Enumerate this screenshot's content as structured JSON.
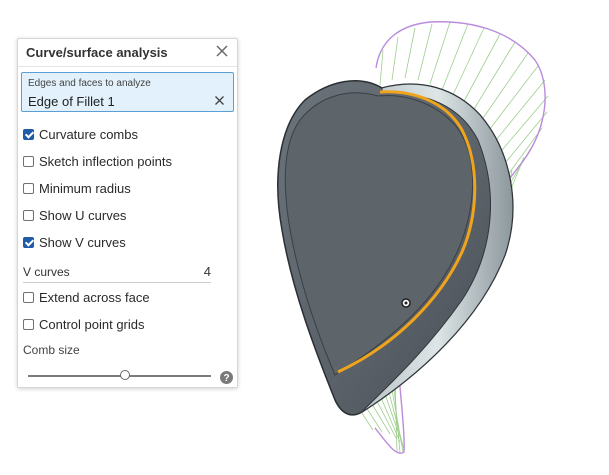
{
  "panel": {
    "title": "Curve/surface analysis",
    "selection": {
      "label": "Edges and faces to analyze",
      "item": "Edge of Fillet 1"
    },
    "options": [
      {
        "label": "Curvature combs",
        "checked": true
      },
      {
        "label": "Sketch inflection points",
        "checked": false
      },
      {
        "label": "Minimum radius",
        "checked": false
      },
      {
        "label": "Show U curves",
        "checked": false
      },
      {
        "label": "Show V curves",
        "checked": true
      }
    ],
    "v_curves": {
      "label": "V curves",
      "value": "4"
    },
    "options2": [
      {
        "label": "Extend across face",
        "checked": false
      },
      {
        "label": "Control point grids",
        "checked": false
      }
    ],
    "comb_size": {
      "label": "Comb size",
      "level": 0.53
    }
  },
  "icons": {
    "close": "close-icon",
    "clear": "clear-selection-icon",
    "help": "help-icon"
  },
  "colors": {
    "accent": "#1f5ba8",
    "selection_bg": "#e2f1fb",
    "selection_border": "#5aa0d6",
    "model_body": "#5f666d",
    "highlight_edge": "#f0a41c",
    "comb_green": "#7fbf6a",
    "comb_outline": "#b07fd6"
  }
}
